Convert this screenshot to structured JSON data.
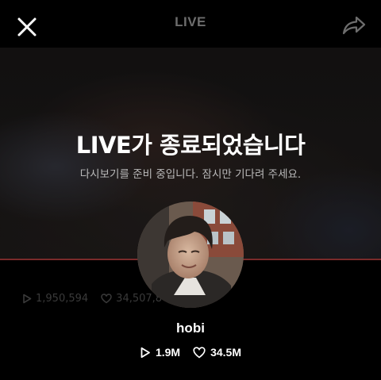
{
  "header": {
    "title": "LIVE",
    "close_icon": "close-icon",
    "share_icon": "share-icon"
  },
  "overlay": {
    "title": "LIVE가 종료되었습니다",
    "subtitle": "다시보기를 준비 중입니다. 잠시만 기다려 주세요."
  },
  "background_stats": {
    "plays": "1,950,594",
    "likes": "34,507,8"
  },
  "profile": {
    "name": "hobi",
    "plays": "1.9M",
    "likes": "34.5M"
  },
  "colors": {
    "background": "#000000",
    "title_gray": "#6d6d6d",
    "progress": "#7a2a2a"
  }
}
